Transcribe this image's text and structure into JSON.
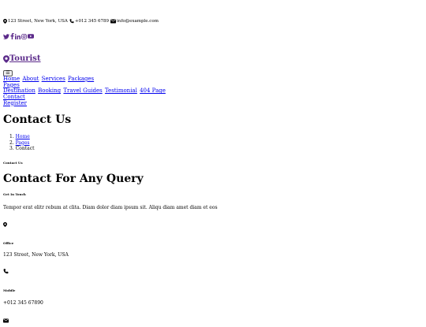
{
  "topbar": {
    "address": "123 Street, New York, USA",
    "phone": "+012 345 6789",
    "email": "info@example.com"
  },
  "social": [
    "twitter-icon",
    "facebook-icon",
    "linkedin-icon",
    "instagram-icon",
    "youtube-icon"
  ],
  "brand": {
    "name": "Tourist",
    "color": "#5b2a8a"
  },
  "toggler": {
    "label": "☰"
  },
  "nav": {
    "row1": [
      "Home",
      "About",
      "Services",
      "Packages"
    ],
    "pages_label": "Pages",
    "row2": [
      "Destination",
      "Booking",
      "Travel Guides",
      "Testimonial",
      "404 Page"
    ],
    "contact": "Contact",
    "register": "Register"
  },
  "page_title": "Contact Us",
  "breadcrumb": [
    {
      "num": "1.",
      "label": "Home"
    },
    {
      "num": "2.",
      "label": "Pages"
    },
    {
      "num": "3.",
      "label": "Contact"
    }
  ],
  "section_label": "Contact Us",
  "section_title": "Contact For Any Query",
  "get_in_touch": {
    "label": "Get In Touch",
    "text": "Tempor erat elitr rebum at clita. Diam dolor diam ipsum sit. Aliqu diam amet diam et eos"
  },
  "office": {
    "label": "Office",
    "value": "123 Street, New York, USA"
  },
  "mobile": {
    "label": "Mobile",
    "value": "+012 345 67890"
  }
}
